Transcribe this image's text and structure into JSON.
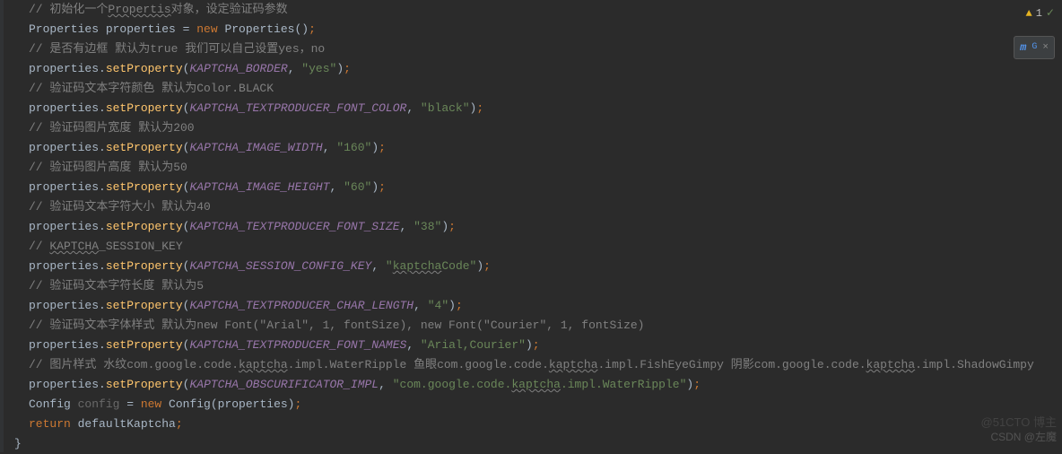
{
  "topRight": {
    "warnCount": "1",
    "warnGlyph": "▲",
    "checkGlyph": "✓"
  },
  "badge": {
    "m": "m",
    "g": "G",
    "close": "×"
  },
  "code": {
    "c1": "// 初始化一个",
    "c1_u": "Propertis",
    "c1_b": "对象，设定验证码参数",
    "l2_a": "Properties properties = ",
    "l2_new": "new ",
    "l2_b": "Properties()",
    "c3": "// 是否有边框 默认为true 我们可以自己设置yes，no",
    "l_prop": "properties.",
    "l_set": "setProperty",
    "p1": "KAPTCHA_BORDER",
    "v1": "\"yes\"",
    "c5": "// 验证码文本字符颜色 默认为Color.BLACK",
    "p2": "KAPTCHA_TEXTPRODUCER_FONT_COLOR",
    "v2": "\"black\"",
    "c7": "// 验证码图片宽度 默认为200",
    "p3": "KAPTCHA_IMAGE_WIDTH",
    "v3": "\"160\"",
    "c9": "// 验证码图片高度 默认为50",
    "p4": "KAPTCHA_IMAGE_HEIGHT",
    "v4": "\"60\"",
    "c11": "// 验证码文本字符大小 默认为40",
    "p5": "KAPTCHA_TEXTPRODUCER_FONT_SIZE",
    "v5": "\"38\"",
    "c13_a": "// ",
    "c13_u": "KAPTCHA",
    "c13_b": "_SESSION_KEY",
    "p6": "KAPTCHA_SESSION_CONFIG_KEY",
    "v6_a": "\"",
    "v6_u": "kaptcha",
    "v6_b": "Code\"",
    "c15": "// 验证码文本字符长度 默认为5",
    "p7": "KAPTCHA_TEXTPRODUCER_CHAR_LENGTH",
    "v7": "\"4\"",
    "c17": "// 验证码文本字体样式 默认为new Font(\"Arial\", 1, fontSize), new Font(\"Courier\", 1, fontSize)",
    "p8": "KAPTCHA_TEXTPRODUCER_FONT_NAMES",
    "v8": "\"Arial,Courier\"",
    "c19_a": "// 图片样式 水纹com.google.code.",
    "c19_u1": "kaptcha",
    "c19_b": ".impl.WaterRipple 鱼眼com.google.code.",
    "c19_u2": "kaptcha",
    "c19_c": ".impl.FishEyeGimpy 阴影com.google.code.",
    "c19_u3": "kaptcha",
    "c19_d": ".impl.ShadowGimpy",
    "p9": "KAPTCHA_OBSCURIFICATOR_IMPL",
    "v9_a": "\"com.google.code.",
    "v9_u": "kaptcha",
    "v9_b": ".impl.WaterRipple\"",
    "l21_a": "Config ",
    "l21_var": "config",
    "l21_eq": " = ",
    "l21_new": "new ",
    "l21_b": "Config(properties)",
    "l22_ret": "return ",
    "l22_b": "defaultKaptcha",
    "close_brace": "}",
    "semi": ";",
    "lp": "(",
    "rp": ")",
    "comma": ", "
  },
  "watermark": "CSDN @左魔",
  "watermark2": "@51CTO 博主"
}
